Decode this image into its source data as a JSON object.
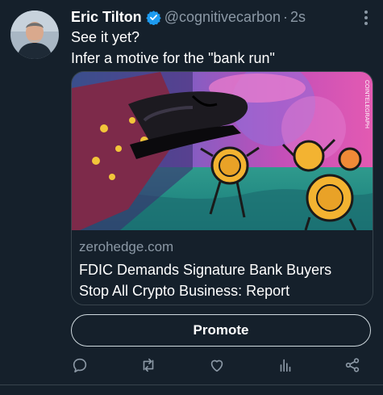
{
  "tweet": {
    "author_name": "Eric Tilton",
    "handle": "@cognitivecarbon",
    "separator": "·",
    "time": "2s",
    "text_line1": "See it yet?",
    "text_line2": "Infer a motive for the \"bank run\""
  },
  "card": {
    "domain": "zerohedge.com",
    "headline": "FDIC Demands Signature Bank Buyers Stop All Crypto Business: Report",
    "image_watermark": "COINTELEGRAPH"
  },
  "promote_button": {
    "label": "Promote"
  },
  "actions": [
    "reply-icon",
    "retweet-icon",
    "like-icon",
    "views-icon",
    "share-icon"
  ],
  "colors": {
    "background": "#15202b",
    "secondary_text": "#8b98a5",
    "border": "#38444d",
    "verified": "#1d9bf0"
  }
}
